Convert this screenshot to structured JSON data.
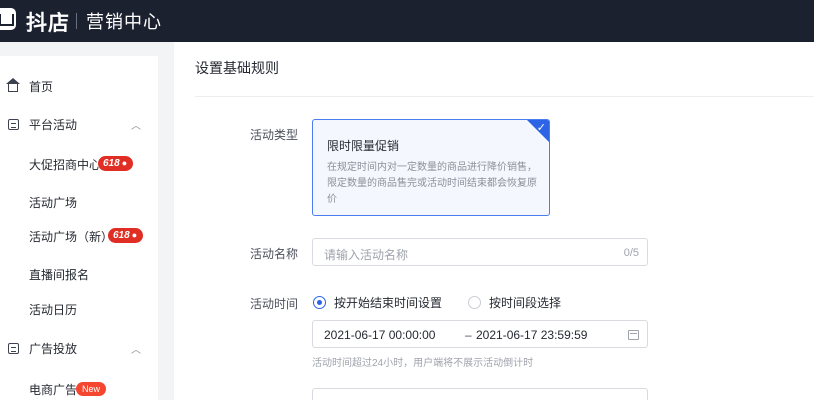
{
  "topbar": {
    "brand": "抖店",
    "subtitle": "营销中心"
  },
  "sidebar": {
    "items": [
      {
        "label": "首页",
        "icon": "home-icon",
        "level": 1
      },
      {
        "label": "平台活动",
        "icon": "activity-icon",
        "level": 1,
        "expanded": true
      },
      {
        "label": "大促招商中心",
        "level": 2,
        "badge": "618",
        "badge_icon": "flame-icon"
      },
      {
        "label": "活动广场",
        "level": 2
      },
      {
        "label": "活动广场（新）",
        "level": 2,
        "badge": "618",
        "badge_icon": "flame-icon"
      },
      {
        "label": "直播间报名",
        "level": 2
      },
      {
        "label": "活动日历",
        "level": 2
      },
      {
        "label": "广告投放",
        "icon": "ad-icon",
        "level": 1,
        "expanded": true
      },
      {
        "label": "电商广告",
        "level": 2,
        "badge": "New"
      }
    ]
  },
  "main": {
    "title": "设置基础规则",
    "activity_type": {
      "label": "活动类型",
      "card_title": "限时限量促销",
      "card_desc": "在规定时间内对一定数量的商品进行降价销售，限定数量的商品售完或活动时间结束都会恢复原价",
      "selected": true
    },
    "activity_name": {
      "label": "活动名称",
      "placeholder": "请输入活动名称",
      "count": "0/5"
    },
    "activity_time": {
      "label": "活动时间",
      "options": [
        "按开始结束时间设置",
        "按时间段选择"
      ],
      "selected_index": 0,
      "start": "2021-06-17 00:00:00",
      "separator": "–",
      "end": "2021-06-17 23:59:59",
      "hint": "活动时间超过24小时，用户端将不展示活动倒计时"
    }
  },
  "colors": {
    "topbar": "#1c2130",
    "accent": "#2d63e5",
    "badge": "#e02e24"
  }
}
